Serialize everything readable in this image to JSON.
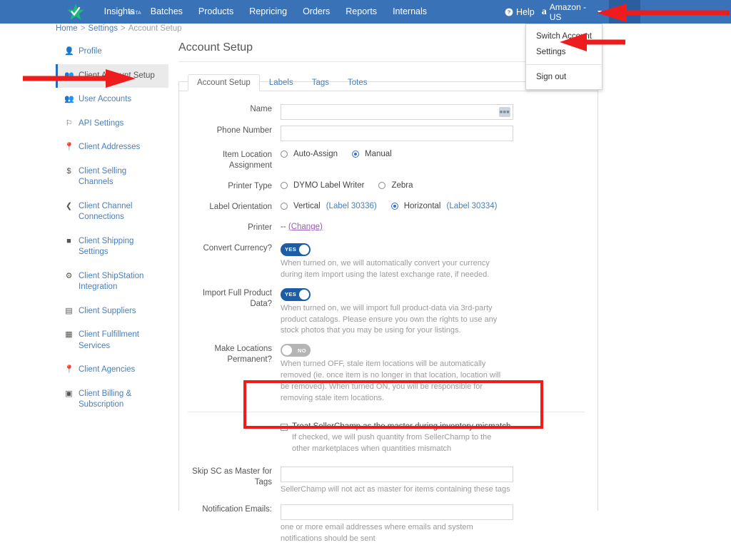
{
  "topnav": {
    "logo": "sellerchamp-star-logo",
    "links": [
      {
        "label": "Insights",
        "badge": "BETA"
      },
      {
        "label": "Batches",
        "badge": ""
      },
      {
        "label": "Products",
        "badge": ""
      },
      {
        "label": "Repricing",
        "badge": ""
      },
      {
        "label": "Orders",
        "badge": ""
      },
      {
        "label": "Reports",
        "badge": ""
      },
      {
        "label": "Internals",
        "badge": ""
      }
    ],
    "help_label": "Help",
    "marketplace_label": "Amazon - US",
    "accent_color": "#3a72b8",
    "user_button_color": "#2c5d9e"
  },
  "user_menu": {
    "items": [
      "Switch Account",
      "Settings",
      "Sign out"
    ]
  },
  "breadcrumb": {
    "home": "Home",
    "settings": "Settings",
    "current": "Account Setup",
    "separator": ">"
  },
  "sidebar": {
    "items": [
      {
        "label": "Profile",
        "icon": "user-icon",
        "active": false
      },
      {
        "label": "Client Account Setup",
        "icon": "users-cog-icon",
        "active": true
      },
      {
        "label": "User Accounts",
        "icon": "users-icon",
        "active": false
      },
      {
        "label": "API Settings",
        "icon": "flag-icon",
        "active": false
      },
      {
        "label": "Client Addresses",
        "icon": "map-pin-icon",
        "active": false
      },
      {
        "label": "Client Selling Channels",
        "icon": "dollar-icon",
        "active": false
      },
      {
        "label": "Client Channel Connections",
        "icon": "share-icon",
        "active": false
      },
      {
        "label": "Client Shipping Settings",
        "icon": "box-icon",
        "active": false
      },
      {
        "label": "Client ShipStation Integration",
        "icon": "gear-icon",
        "active": false
      },
      {
        "label": "Client Suppliers",
        "icon": "truck-icon",
        "active": false
      },
      {
        "label": "Client Fulfillment Services",
        "icon": "warehouse-icon",
        "active": false
      },
      {
        "label": "Client Agencies",
        "icon": "map-pin-icon",
        "active": false
      },
      {
        "label": "Client Billing & Subscription",
        "icon": "credit-card-icon",
        "active": false
      }
    ]
  },
  "main": {
    "page_title": "Account Setup",
    "tabs": [
      {
        "label": "Account Setup",
        "active": true
      },
      {
        "label": "Labels",
        "active": false
      },
      {
        "label": "Tags",
        "active": false
      },
      {
        "label": "Totes",
        "active": false
      }
    ],
    "fields": {
      "name": {
        "label": "Name",
        "value": "",
        "placeholder": "",
        "badge_icon": "keyboard-icon"
      },
      "phone": {
        "label": "Phone Number",
        "value": "",
        "placeholder": ""
      },
      "item_location": {
        "label": "Item Location Assignment",
        "options": [
          {
            "label": "Auto-Assign",
            "selected": false
          },
          {
            "label": "Manual",
            "selected": true
          }
        ]
      },
      "printer_type": {
        "label": "Printer Type",
        "options": [
          {
            "label": "DYMO Label Writer",
            "selected": false
          },
          {
            "label": "Zebra",
            "selected": false
          }
        ]
      },
      "label_orientation": {
        "label": "Label Orientation",
        "options": [
          {
            "label": "Vertical",
            "sub": "(Label 30336)",
            "selected": false
          },
          {
            "label": "Horizontal",
            "sub": "(Label 30334)",
            "selected": true
          }
        ]
      },
      "printer": {
        "label": "Printer",
        "value": "--",
        "change_link": "(Change)"
      },
      "convert_currency": {
        "label": "Convert Currency?",
        "state": "YES",
        "on": true,
        "help": "When turned on, we will automatically convert your currency during item import using the latest exchange rate, if needed."
      },
      "import_full_product_data": {
        "label": "Import Full Product Data?",
        "state": "YES",
        "on": true,
        "help": "When turned on, we will import full product-data via 3rd-party product catalogs. Please ensure you own the rights to use any stock photos that you may be using for your listings."
      },
      "make_locations_permanent": {
        "label": "Make Locations Permanent?",
        "state": "NO",
        "on": false,
        "help": "When turned OFF, stale item locations will be automatically removed (ie. once item is no longer in that location, location will be removed). When turned ON, you will be responsible for removing stale item locations."
      },
      "treat_master": {
        "checkbox_label": "Treat SellerChamp as the master during inventory mismatch",
        "checked": false,
        "help": "If checked, we will push quantity from SellerChamp to the other marketplaces when quantities mismatch",
        "highlight_color": "#ee1c1c"
      },
      "skip_sc_tags": {
        "label": "Skip SC as Master for Tags",
        "value": "",
        "help": "SellerChamp will not act as master for items containing these tags"
      },
      "notification_emails": {
        "label": "Notification Emails:",
        "value": "",
        "help": "one or more email addresses where emails and system notifications should be sent"
      }
    }
  },
  "annotations": {
    "color": "#ee1c1c",
    "arrows": [
      {
        "name": "arrow-to-user-menu-button",
        "direction": "left"
      },
      {
        "name": "arrow-to-settings-menu-item",
        "direction": "left"
      },
      {
        "name": "arrow-to-client-account-setup",
        "direction": "right"
      }
    ]
  }
}
